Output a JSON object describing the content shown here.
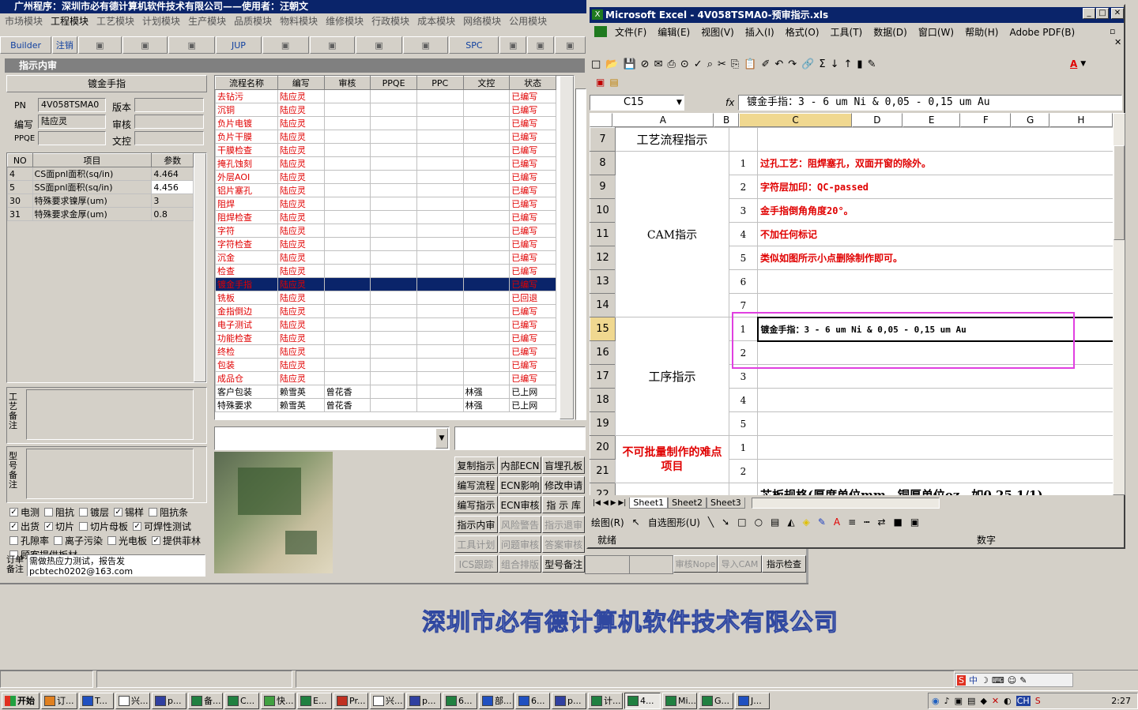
{
  "host": {
    "title": "广州程序：深圳市必有德计算机软件技术有限公司——使用者：汪朝文",
    "menu": [
      "市场模块",
      "工程模块",
      "工艺模块",
      "计划模块",
      "生产模块",
      "品质模块",
      "物料模块",
      "维修模块",
      "行政模块",
      "成本模块",
      "网络模块",
      "公用模块"
    ],
    "toolbar": [
      "Builder",
      "注销",
      "",
      "",
      "",
      "JUP",
      "",
      "",
      "",
      "",
      "SPC",
      "",
      "",
      ""
    ],
    "panel_title": "指示内审"
  },
  "left": {
    "section_title": "镀金手指",
    "pn_label": "PN",
    "pn_value": "4V058TSMA0",
    "version_label": "版本",
    "writer_label": "编写",
    "writer_value": "陆应灵",
    "review_label": "审核",
    "ppqe_label": "PPQE",
    "docctl_label": "文控",
    "params_headers": [
      "NO",
      "项目",
      "参数"
    ],
    "params": [
      [
        "4",
        "CS面pnl面积(sq/in)",
        "4.464"
      ],
      [
        "5",
        "SS面pnl面积(sq/in)",
        "4.456"
      ],
      [
        "30",
        "特殊要求镍厚(um)",
        "3"
      ],
      [
        "31",
        "特殊要求金厚(um)",
        "0.8"
      ]
    ],
    "note1_label": "工艺备注",
    "note2_label": "型号备注",
    "checks": [
      [
        "电测",
        true
      ],
      [
        "阻抗",
        false
      ],
      [
        "镀层",
        false
      ],
      [
        "锡样",
        true
      ],
      [
        "阻抗条",
        false
      ],
      [
        "出货",
        true
      ],
      [
        "切片",
        true
      ],
      [
        "切片母板",
        false
      ],
      [
        "可焊性测试",
        true
      ],
      [
        "孔隙率",
        false
      ],
      [
        "离子污染",
        false
      ],
      [
        "光电板",
        false
      ],
      [
        "提供菲林",
        true
      ],
      [
        "顾客提供板材",
        false
      ]
    ],
    "order_label": "订单备注",
    "order_text": "需做热应力测试，报告发 pcbtech0202@163.com"
  },
  "flow": {
    "headers": [
      "流程名称",
      "编写",
      "审核",
      "PPQE",
      "PPC",
      "文控",
      "状态"
    ],
    "rows": [
      [
        "去钻污",
        "陆应灵",
        "",
        "",
        "",
        "",
        "已编写"
      ],
      [
        "沉铜",
        "陆应灵",
        "",
        "",
        "",
        "",
        "已编写"
      ],
      [
        "负片电镀",
        "陆应灵",
        "",
        "",
        "",
        "",
        "已编写"
      ],
      [
        "负片干膜",
        "陆应灵",
        "",
        "",
        "",
        "",
        "已编写"
      ],
      [
        "干膜检查",
        "陆应灵",
        "",
        "",
        "",
        "",
        "已编写"
      ],
      [
        "掩孔蚀刻",
        "陆应灵",
        "",
        "",
        "",
        "",
        "已编写"
      ],
      [
        "外层AOI",
        "陆应灵",
        "",
        "",
        "",
        "",
        "已编写"
      ],
      [
        "铝片塞孔",
        "陆应灵",
        "",
        "",
        "",
        "",
        "已编写"
      ],
      [
        "阻焊",
        "陆应灵",
        "",
        "",
        "",
        "",
        "已编写"
      ],
      [
        "阻焊检查",
        "陆应灵",
        "",
        "",
        "",
        "",
        "已编写"
      ],
      [
        "字符",
        "陆应灵",
        "",
        "",
        "",
        "",
        "已编写"
      ],
      [
        "字符检查",
        "陆应灵",
        "",
        "",
        "",
        "",
        "已编写"
      ],
      [
        "沉金",
        "陆应灵",
        "",
        "",
        "",
        "",
        "已编写"
      ],
      [
        "检查",
        "陆应灵",
        "",
        "",
        "",
        "",
        "已编写"
      ],
      [
        "镀金手指",
        "陆应灵",
        "",
        "",
        "",
        "",
        "已编写"
      ],
      [
        "铣板",
        "陆应灵",
        "",
        "",
        "",
        "",
        "已回退"
      ],
      [
        "金指倒边",
        "陆应灵",
        "",
        "",
        "",
        "",
        "已编写"
      ],
      [
        "电子测试",
        "陆应灵",
        "",
        "",
        "",
        "",
        "已编写"
      ],
      [
        "功能检查",
        "陆应灵",
        "",
        "",
        "",
        "",
        "已编写"
      ],
      [
        "终检",
        "陆应灵",
        "",
        "",
        "",
        "",
        "已编写"
      ],
      [
        "包装",
        "陆应灵",
        "",
        "",
        "",
        "",
        "已编写"
      ],
      [
        "成品仓",
        "陆应灵",
        "",
        "",
        "",
        "",
        "已编写"
      ],
      [
        "客户包装",
        "赖雪英",
        "曾花香",
        "",
        "",
        "林强",
        "已上网"
      ],
      [
        "特殊要求",
        "赖雪英",
        "曾花香",
        "",
        "",
        "林强",
        "已上网"
      ]
    ]
  },
  "buttons": [
    [
      "复制指示",
      "内部ECN",
      "盲埋孔板"
    ],
    [
      "编写流程",
      "ECN影响",
      "修改申请"
    ],
    [
      "编写指示",
      "ECN审核",
      "指 示 库"
    ],
    [
      "指示内审",
      "风险警告",
      "指示退审"
    ],
    [
      "工具计划",
      "问题审核",
      "答案审核"
    ],
    [
      "ICS跟踪",
      "组合排版",
      "型号备注"
    ]
  ],
  "bottom_buttons": [
    "审核Nope",
    "导入CAM",
    "指示检查"
  ],
  "company": "深圳市必有德计算机软件技术有限公司",
  "excel": {
    "title": "Microsoft Excel - 4V058TSMA0-预审指示.xls",
    "menu": [
      "文件(F)",
      "编辑(E)",
      "视图(V)",
      "插入(I)",
      "格式(O)",
      "工具(T)",
      "数据(D)",
      "窗口(W)",
      "帮助(H)",
      "Adobe PDF(B)"
    ],
    "name_box": "C15",
    "formula": "镀金手指：3 - 6 um Ni & 0,05 - 0,15 um Au",
    "cols": [
      "A",
      "B",
      "C",
      "D",
      "E",
      "F",
      "G",
      "H"
    ],
    "row_numbers": [
      "7",
      "8",
      "9",
      "10",
      "11",
      "12",
      "13",
      "14",
      "15",
      "16",
      "17",
      "18",
      "19",
      "20",
      "21",
      "22"
    ],
    "a7": "工艺流程指示",
    "cam": "CAM指示",
    "process": "工序指示",
    "hard": "不可批量制作的难点项目",
    "cam_items": [
      [
        "1",
        "过孔工艺：阻焊塞孔，双面开窗的除外。"
      ],
      [
        "2",
        "字符层加印：QC-passed"
      ],
      [
        "3",
        "金手指倒角角度20°。"
      ],
      [
        "4",
        "不加任何标记"
      ],
      [
        "5",
        "类似如图所示小点删除制作即可。"
      ],
      [
        "6",
        ""
      ],
      [
        "7",
        ""
      ]
    ],
    "proc_items": [
      [
        "1",
        "镀金手指：3 - 6 um Ni & 0,05 - 0,15 um Au"
      ],
      [
        "2",
        ""
      ],
      [
        "3",
        ""
      ],
      [
        "4",
        ""
      ],
      [
        "5",
        ""
      ]
    ],
    "hard_items": [
      [
        "1",
        ""
      ],
      [
        "2",
        ""
      ]
    ],
    "row22": "芯板规格(厚度单位mm，铜厚单位oz，如0.25 1/1)",
    "sheets": [
      "Sheet1",
      "Sheet2",
      "Sheet3"
    ],
    "draw_label": "绘图(R)",
    "autoshape_label": "自选图形(U)",
    "status_left": "就绪",
    "status_right": "数字"
  },
  "taskbar": {
    "start": "开始",
    "tasks": [
      "订...",
      "T...",
      "兴...",
      "p...",
      "备...",
      "C...",
      "快...",
      "E...",
      "Pr...",
      "兴...",
      "p...",
      "6...",
      "部...",
      "6...",
      "p...",
      "计...",
      "4...",
      "Mi...",
      "G...",
      "J..."
    ],
    "clock": "2:27",
    "ime": "CH"
  },
  "colors": {
    "title_bar": "#0a246a",
    "highlight": "#e040e0",
    "red_text": "#e00000"
  }
}
